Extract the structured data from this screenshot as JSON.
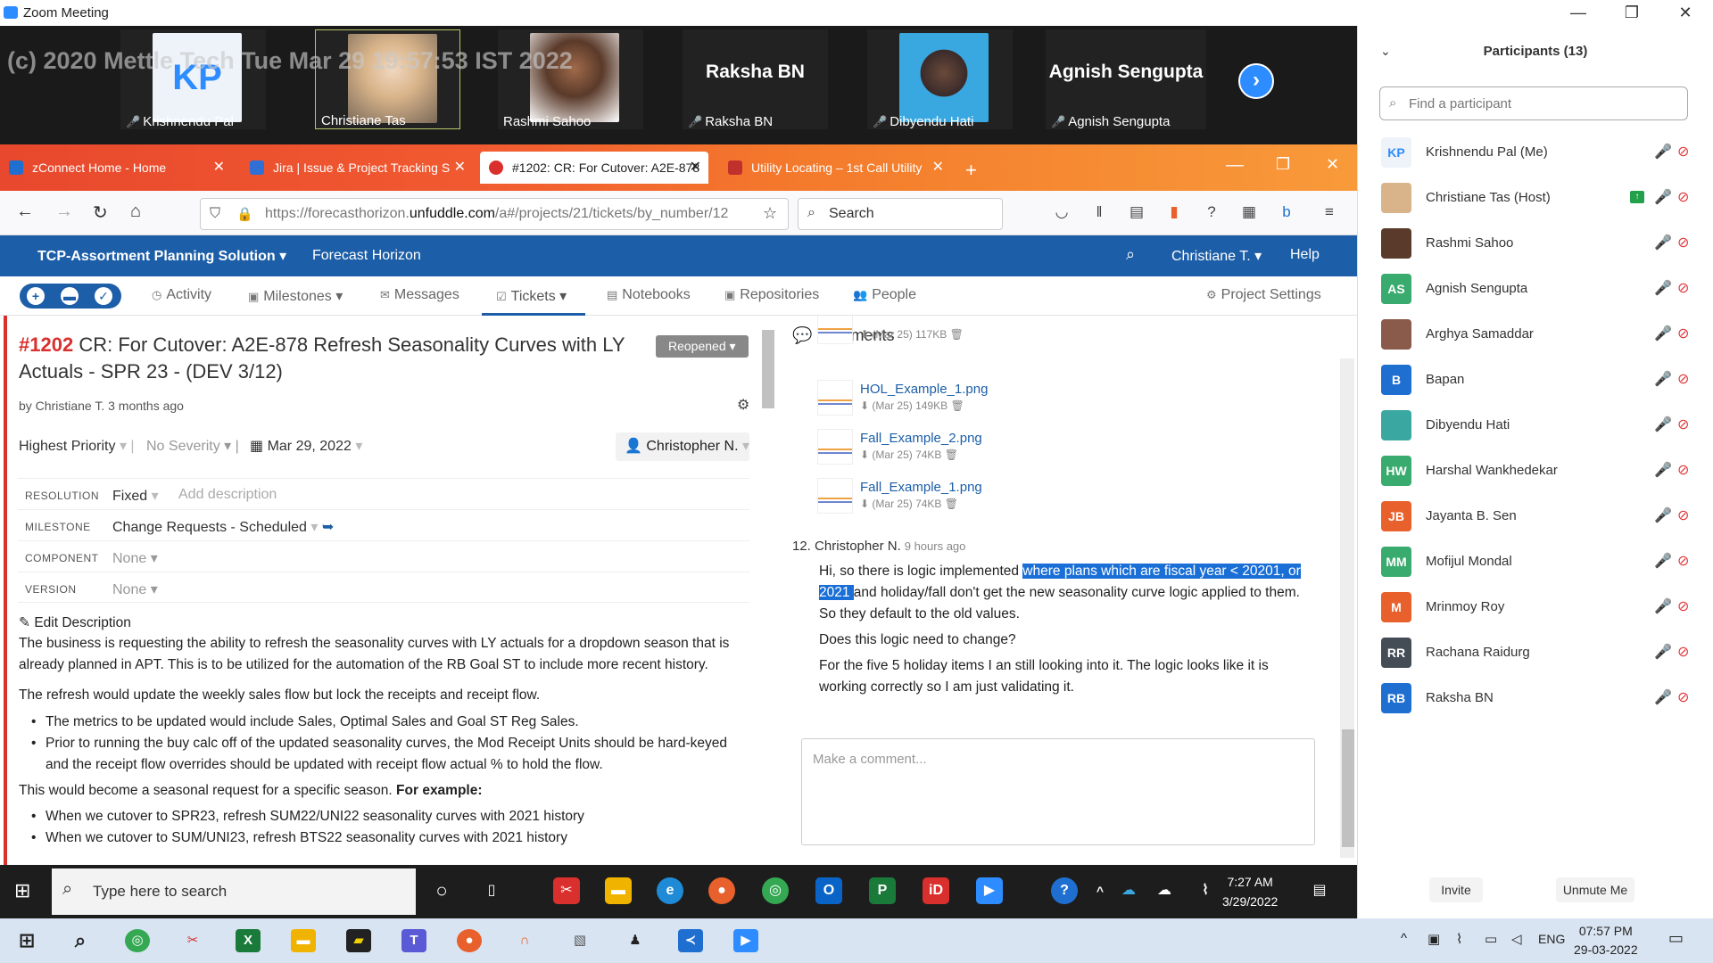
{
  "zoom": {
    "window_title": "Zoom Meeting",
    "watermark": "(c) 2020 Mettle Tech Tue Mar 29 19:57:53 IST 2022",
    "tiles": [
      {
        "name": "Krishnendu Pal",
        "initials": "KP"
      },
      {
        "name": "Christiane Tas"
      },
      {
        "name": "Rashmi Sahoo"
      },
      {
        "name": "Raksha BN",
        "big": "Raksha BN"
      },
      {
        "name": "Dibyendu Hati"
      },
      {
        "name": "Agnish Sengupta",
        "big": "Agnish Sengupta"
      }
    ]
  },
  "browser": {
    "tabs": [
      {
        "label": "zConnect Home - Home"
      },
      {
        "label": "Jira | Issue & Project Tracking S"
      },
      {
        "label": "#1202: CR: For Cutover: A2E-878"
      },
      {
        "label": "Utility Locating – 1st Call Utility"
      }
    ],
    "url_prefix": "https://forecasthorizon.",
    "url_domain": "unfuddle.com",
    "url_suffix": "/a#/projects/21/tickets/by_number/12",
    "search_placeholder": "Search"
  },
  "app": {
    "project": "TCP-Assortment Planning Solution",
    "subproject": "Forecast Horizon",
    "user": "Christiane T.",
    "help": "Help",
    "nav": [
      "Activity",
      "Milestones",
      "Messages",
      "Tickets",
      "Notebooks",
      "Repositories",
      "People"
    ],
    "settings": "Project Settings"
  },
  "ticket": {
    "number": "#1202",
    "title": "CR: For Cutover: A2E-878 Refresh Seasonality Curves with LY Actuals - SPR 23 - (DEV 3/12)",
    "status": "Reopened",
    "byline": "by Christiane T. 3 months ago",
    "priority": "Highest Priority",
    "severity": "No Severity",
    "due": "Mar 29, 2022",
    "assignee": "Christopher N.",
    "fields": [
      {
        "key": "RESOLUTION",
        "value": "Fixed",
        "extra": "Add description"
      },
      {
        "key": "MILESTONE",
        "value": "Change Requests - Scheduled"
      },
      {
        "key": "COMPONENT",
        "value": "None"
      },
      {
        "key": "VERSION",
        "value": "None"
      }
    ],
    "edit_description": "Edit Description",
    "p1": "The business is requesting the ability to refresh the seasonality curves with LY actuals for a dropdown season that is already planned in APT. This is to be utilized for the automation of the RB Goal ST to include more recent history.",
    "p2": "The refresh would update the weekly sales flow but lock the receipts and receipt flow.",
    "b1": "The metrics to be updated would include Sales, Optimal Sales and Goal ST Reg Sales.",
    "b2": "Prior to running the buy calc off of the updated seasonality curves, the Mod Receipt Units should be hard-keyed and the receipt flow overrides should be updated with receipt flow actual % to hold the flow.",
    "p3a": "This would become a seasonal request for a specific season.",
    "p3b": "For example:",
    "b3": "When we cutover to SPR23, refresh SUM22/UNI22 seasonality curves with 2021 history",
    "b4": "When we cutover to SUM/UNI23, refresh BTS22 seasonality curves with 2021 history"
  },
  "comments": {
    "header": "Comments",
    "attachments": [
      {
        "name": "",
        "info": "(Mar 25) 117KB"
      },
      {
        "name": "HOL_Example_1.png",
        "info": "(Mar 25) 149KB"
      },
      {
        "name": "Fall_Example_2.png",
        "info": "(Mar 25) 74KB"
      },
      {
        "name": "Fall_Example_1.png",
        "info": "(Mar 25) 74KB"
      }
    ],
    "index": "12.",
    "author": "Christopher N.",
    "when": "9 hours ago",
    "c1a": "Hi, so there is logic implemented ",
    "c1hl1": "where plans which are fiscal  year < 20201, or",
    "c1hl2": "2021 ",
    "c1b": "and holiday/fall don't get the new seasonality curve logic applied to them. So they default to the old values.",
    "c2": "Does this logic need to change?",
    "c3": "For the five 5 holiday items I an still looking into it. The logic looks like it is working correctly so I am just validating it.",
    "placeholder": "Make a comment..."
  },
  "taskbar_inner": {
    "search": "Type here to search",
    "time": "7:27 AM",
    "date": "3/29/2022"
  },
  "participants": {
    "title": "Participants (13)",
    "find_placeholder": "Find a participant",
    "list": [
      {
        "initials": "KP",
        "name": "Krishnendu Pal (Me)",
        "color": "#eef3fa"
      },
      {
        "initials": "",
        "name": "Christiane Tas (Host)",
        "color": "#d9b48a"
      },
      {
        "initials": "",
        "name": "Rashmi Sahoo",
        "color": "#5a3a2a"
      },
      {
        "initials": "AS",
        "name": "Agnish Sengupta",
        "color": "#3aab6e"
      },
      {
        "initials": "",
        "name": "Arghya Samaddar",
        "color": "#8a5a4a"
      },
      {
        "initials": "B",
        "name": "Bapan",
        "color": "#1f6fd1"
      },
      {
        "initials": "",
        "name": "Dibyendu Hati",
        "color": "#3aa8a0"
      },
      {
        "initials": "HW",
        "name": "Harshal Wankhedekar",
        "color": "#3aab6e"
      },
      {
        "initials": "JB",
        "name": "Jayanta B. Sen",
        "color": "#e8602c"
      },
      {
        "initials": "MM",
        "name": "Mofijul Mondal",
        "color": "#3aab6e"
      },
      {
        "initials": "M",
        "name": "Mrinmoy Roy",
        "color": "#e8602c"
      },
      {
        "initials": "RR",
        "name": "Rachana Raidurg",
        "color": "#444c56"
      },
      {
        "initials": "RB",
        "name": "Raksha BN",
        "color": "#1f6fd1"
      }
    ],
    "invite": "Invite",
    "unmute": "Unmute Me"
  },
  "taskbar_outer": {
    "lang": "ENG",
    "time": "07:57 PM",
    "date": "29-03-2022"
  }
}
